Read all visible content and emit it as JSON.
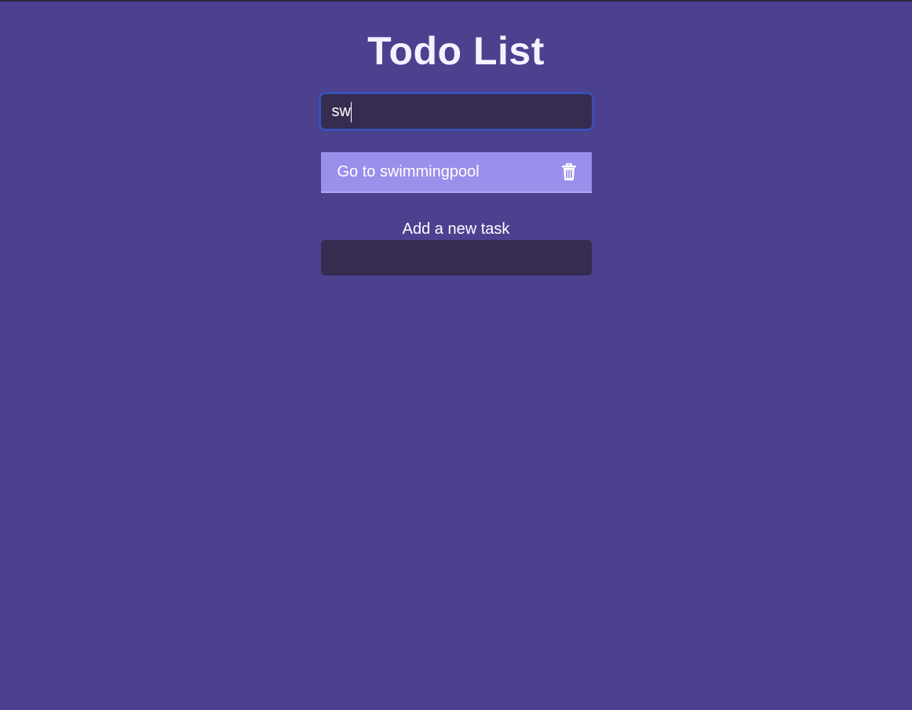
{
  "app": {
    "title": "Todo List"
  },
  "search": {
    "value": "sw",
    "placeholder": ""
  },
  "tasks": [
    {
      "text": "Go to swimmingpool",
      "delete_icon": "trash-icon"
    }
  ],
  "add_task": {
    "label": "Add a new task",
    "value": "",
    "placeholder": ""
  },
  "colors": {
    "background": "#4b418f",
    "input_background": "#352c4f",
    "task_background": "#9b8fec",
    "focus_outline": "#3a4fb8",
    "text": "#ffffff"
  }
}
